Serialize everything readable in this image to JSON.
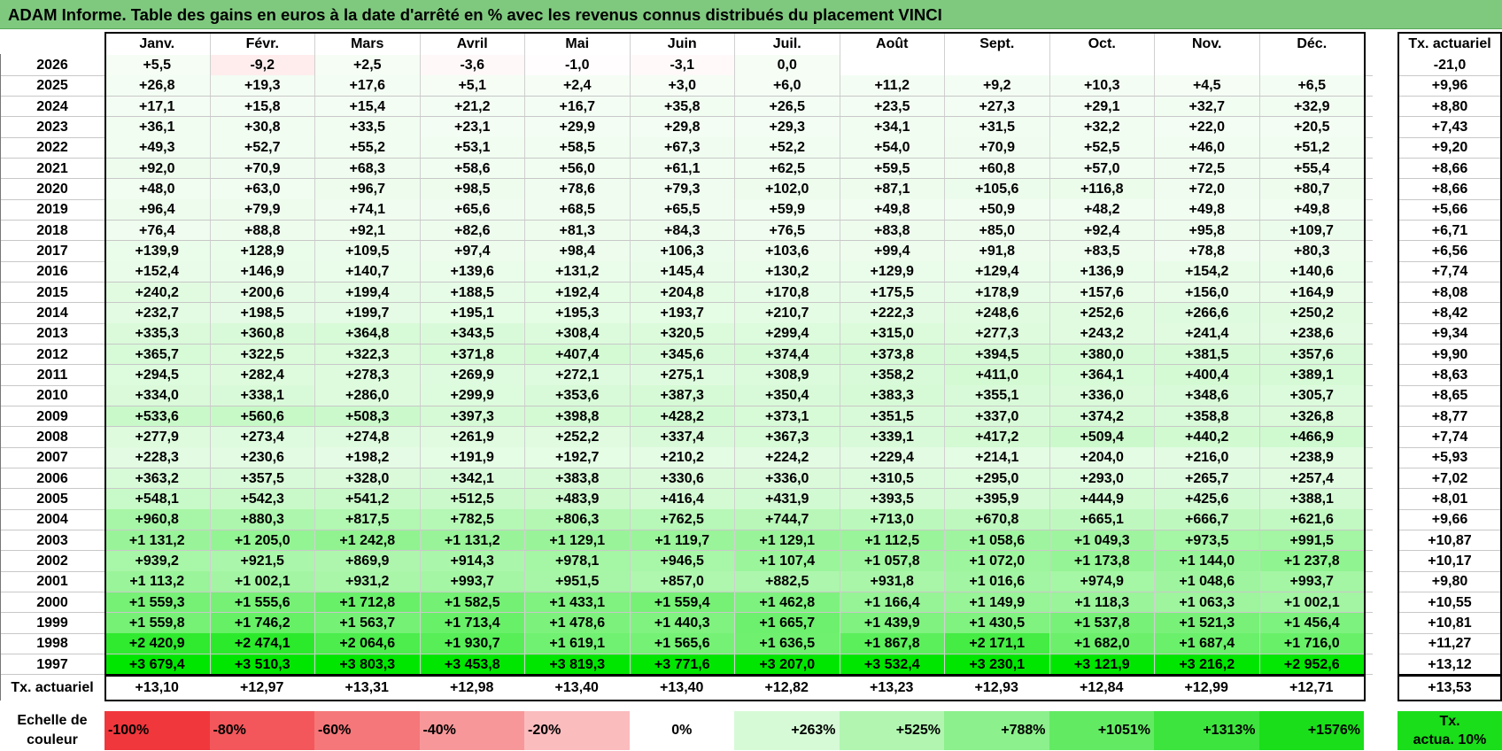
{
  "title": "ADAM Informe. Table des gains en euros à la date d'arrêté en % avec les revenus connus distribués du placement VINCI",
  "months": [
    "Janv.",
    "Févr.",
    "Mars",
    "Avril",
    "Mai",
    "Juin",
    "Juil.",
    "Août",
    "Sept.",
    "Oct.",
    "Nov.",
    "Déc."
  ],
  "rate_header": "Tx. actuariel",
  "rows": [
    {
      "year": "2026",
      "values": [
        "+5,5",
        "-9,2",
        "+2,5",
        "-3,6",
        "-1,0",
        "-3,1",
        "0,0",
        "",
        "",
        "",
        "",
        ""
      ],
      "rate": "-21,0"
    },
    {
      "year": "2025",
      "values": [
        "+26,8",
        "+19,3",
        "+17,6",
        "+5,1",
        "+2,4",
        "+3,0",
        "+6,0",
        "+11,2",
        "+9,2",
        "+10,3",
        "+4,5",
        "+6,5"
      ],
      "rate": "+9,96"
    },
    {
      "year": "2024",
      "values": [
        "+17,1",
        "+15,8",
        "+15,4",
        "+21,2",
        "+16,7",
        "+35,8",
        "+26,5",
        "+23,5",
        "+27,3",
        "+29,1",
        "+32,7",
        "+32,9"
      ],
      "rate": "+8,80"
    },
    {
      "year": "2023",
      "values": [
        "+36,1",
        "+30,8",
        "+33,5",
        "+23,1",
        "+29,9",
        "+29,8",
        "+29,3",
        "+34,1",
        "+31,5",
        "+32,2",
        "+22,0",
        "+20,5"
      ],
      "rate": "+7,43"
    },
    {
      "year": "2022",
      "values": [
        "+49,3",
        "+52,7",
        "+55,2",
        "+53,1",
        "+58,5",
        "+67,3",
        "+52,2",
        "+54,0",
        "+70,9",
        "+52,5",
        "+46,0",
        "+51,2"
      ],
      "rate": "+9,20"
    },
    {
      "year": "2021",
      "values": [
        "+92,0",
        "+70,9",
        "+68,3",
        "+58,6",
        "+56,0",
        "+61,1",
        "+62,5",
        "+59,5",
        "+60,8",
        "+57,0",
        "+72,5",
        "+55,4"
      ],
      "rate": "+8,66"
    },
    {
      "year": "2020",
      "values": [
        "+48,0",
        "+63,0",
        "+96,7",
        "+98,5",
        "+78,6",
        "+79,3",
        "+102,0",
        "+87,1",
        "+105,6",
        "+116,8",
        "+72,0",
        "+80,7"
      ],
      "rate": "+8,66"
    },
    {
      "year": "2019",
      "values": [
        "+96,4",
        "+79,9",
        "+74,1",
        "+65,6",
        "+68,5",
        "+65,5",
        "+59,9",
        "+49,8",
        "+50,9",
        "+48,2",
        "+49,8",
        "+49,8"
      ],
      "rate": "+5,66"
    },
    {
      "year": "2018",
      "values": [
        "+76,4",
        "+88,8",
        "+92,1",
        "+82,6",
        "+81,3",
        "+84,3",
        "+76,5",
        "+83,8",
        "+85,0",
        "+92,4",
        "+95,8",
        "+109,7"
      ],
      "rate": "+6,71"
    },
    {
      "year": "2017",
      "values": [
        "+139,9",
        "+128,9",
        "+109,5",
        "+97,4",
        "+98,4",
        "+106,3",
        "+103,6",
        "+99,4",
        "+91,8",
        "+83,5",
        "+78,8",
        "+80,3"
      ],
      "rate": "+6,56"
    },
    {
      "year": "2016",
      "values": [
        "+152,4",
        "+146,9",
        "+140,7",
        "+139,6",
        "+131,2",
        "+145,4",
        "+130,2",
        "+129,9",
        "+129,4",
        "+136,9",
        "+154,2",
        "+140,6"
      ],
      "rate": "+7,74"
    },
    {
      "year": "2015",
      "values": [
        "+240,2",
        "+200,6",
        "+199,4",
        "+188,5",
        "+192,4",
        "+204,8",
        "+170,8",
        "+175,5",
        "+178,9",
        "+157,6",
        "+156,0",
        "+164,9"
      ],
      "rate": "+8,08"
    },
    {
      "year": "2014",
      "values": [
        "+232,7",
        "+198,5",
        "+199,7",
        "+195,1",
        "+195,3",
        "+193,7",
        "+210,7",
        "+222,3",
        "+248,6",
        "+252,6",
        "+266,6",
        "+250,2"
      ],
      "rate": "+8,42"
    },
    {
      "year": "2013",
      "values": [
        "+335,3",
        "+360,8",
        "+364,8",
        "+343,5",
        "+308,4",
        "+320,5",
        "+299,4",
        "+315,0",
        "+277,3",
        "+243,2",
        "+241,4",
        "+238,6"
      ],
      "rate": "+9,34"
    },
    {
      "year": "2012",
      "values": [
        "+365,7",
        "+322,5",
        "+322,3",
        "+371,8",
        "+407,4",
        "+345,6",
        "+374,4",
        "+373,8",
        "+394,5",
        "+380,0",
        "+381,5",
        "+357,6"
      ],
      "rate": "+9,90"
    },
    {
      "year": "2011",
      "values": [
        "+294,5",
        "+282,4",
        "+278,3",
        "+269,9",
        "+272,1",
        "+275,1",
        "+308,9",
        "+358,2",
        "+411,0",
        "+364,1",
        "+400,4",
        "+389,1"
      ],
      "rate": "+8,63"
    },
    {
      "year": "2010",
      "values": [
        "+334,0",
        "+338,1",
        "+286,0",
        "+299,9",
        "+353,6",
        "+387,3",
        "+350,4",
        "+383,3",
        "+355,1",
        "+336,0",
        "+348,6",
        "+305,7"
      ],
      "rate": "+8,65"
    },
    {
      "year": "2009",
      "values": [
        "+533,6",
        "+560,6",
        "+508,3",
        "+397,3",
        "+398,8",
        "+428,2",
        "+373,1",
        "+351,5",
        "+337,0",
        "+374,2",
        "+358,8",
        "+326,8"
      ],
      "rate": "+8,77"
    },
    {
      "year": "2008",
      "values": [
        "+277,9",
        "+273,4",
        "+274,8",
        "+261,9",
        "+252,2",
        "+337,4",
        "+367,3",
        "+339,1",
        "+417,2",
        "+509,4",
        "+440,2",
        "+466,9"
      ],
      "rate": "+7,74"
    },
    {
      "year": "2007",
      "values": [
        "+228,3",
        "+230,6",
        "+198,2",
        "+191,9",
        "+192,7",
        "+210,2",
        "+224,2",
        "+229,4",
        "+214,1",
        "+204,0",
        "+216,0",
        "+238,9"
      ],
      "rate": "+5,93"
    },
    {
      "year": "2006",
      "values": [
        "+363,2",
        "+357,5",
        "+328,0",
        "+342,1",
        "+383,8",
        "+330,6",
        "+336,0",
        "+310,5",
        "+295,0",
        "+293,0",
        "+265,7",
        "+257,4"
      ],
      "rate": "+7,02"
    },
    {
      "year": "2005",
      "values": [
        "+548,1",
        "+542,3",
        "+541,2",
        "+512,5",
        "+483,9",
        "+416,4",
        "+431,9",
        "+393,5",
        "+395,9",
        "+444,9",
        "+425,6",
        "+388,1"
      ],
      "rate": "+8,01"
    },
    {
      "year": "2004",
      "values": [
        "+960,8",
        "+880,3",
        "+817,5",
        "+782,5",
        "+806,3",
        "+762,5",
        "+744,7",
        "+713,0",
        "+670,8",
        "+665,1",
        "+666,7",
        "+621,6"
      ],
      "rate": "+9,66"
    },
    {
      "year": "2003",
      "values": [
        "+1 131,2",
        "+1 205,0",
        "+1 242,8",
        "+1 131,2",
        "+1 129,1",
        "+1 119,7",
        "+1 129,1",
        "+1 112,5",
        "+1 058,6",
        "+1 049,3",
        "+973,5",
        "+991,5"
      ],
      "rate": "+10,87"
    },
    {
      "year": "2002",
      "values": [
        "+939,2",
        "+921,5",
        "+869,9",
        "+914,3",
        "+978,1",
        "+946,5",
        "+1 107,4",
        "+1 057,8",
        "+1 072,0",
        "+1 173,8",
        "+1 144,0",
        "+1 237,8"
      ],
      "rate": "+10,17"
    },
    {
      "year": "2001",
      "values": [
        "+1 113,2",
        "+1 002,1",
        "+931,2",
        "+993,7",
        "+951,5",
        "+857,0",
        "+882,5",
        "+931,8",
        "+1 016,6",
        "+974,9",
        "+1 048,6",
        "+993,7"
      ],
      "rate": "+9,80"
    },
    {
      "year": "2000",
      "values": [
        "+1 559,3",
        "+1 555,6",
        "+1 712,8",
        "+1 582,5",
        "+1 433,1",
        "+1 559,4",
        "+1 462,8",
        "+1 166,4",
        "+1 149,9",
        "+1 118,3",
        "+1 063,3",
        "+1 002,1"
      ],
      "rate": "+10,55"
    },
    {
      "year": "1999",
      "values": [
        "+1 559,8",
        "+1 746,2",
        "+1 563,7",
        "+1 713,4",
        "+1 478,6",
        "+1 440,3",
        "+1 665,7",
        "+1 439,9",
        "+1 430,5",
        "+1 537,8",
        "+1 521,3",
        "+1 456,4"
      ],
      "rate": "+10,81"
    },
    {
      "year": "1998",
      "values": [
        "+2 420,9",
        "+2 474,1",
        "+2 064,6",
        "+1 930,7",
        "+1 619,1",
        "+1 565,6",
        "+1 636,5",
        "+1 867,8",
        "+2 171,1",
        "+1 682,0",
        "+1 687,4",
        "+1 716,0"
      ],
      "rate": "+11,27"
    },
    {
      "year": "1997",
      "values": [
        "+3 679,4",
        "+3 510,3",
        "+3 803,3",
        "+3 453,8",
        "+3 819,3",
        "+3 771,6",
        "+3 207,0",
        "+3 532,4",
        "+3 230,1",
        "+3 121,9",
        "+3 216,2",
        "+2 952,6"
      ],
      "rate": "+13,12"
    }
  ],
  "rate_row": {
    "label": "Tx. actuariel",
    "values": [
      "+13,10",
      "+12,97",
      "+13,31",
      "+12,98",
      "+13,40",
      "+13,40",
      "+12,82",
      "+13,23",
      "+12,93",
      "+12,84",
      "+12,99",
      "+12,71"
    ],
    "rate": "+13,53"
  },
  "legend": {
    "label_line1": "Echelle de",
    "label_line2": "couleur",
    "steps": [
      {
        "text": "-100%",
        "color": "#f0373c",
        "align": "left"
      },
      {
        "text": "-80%",
        "color": "#f3575b",
        "align": "left"
      },
      {
        "text": "-60%",
        "color": "#f5777a",
        "align": "left"
      },
      {
        "text": "-40%",
        "color": "#f89799",
        "align": "left"
      },
      {
        "text": "-20%",
        "color": "#fbbcbe",
        "align": "left"
      },
      {
        "text": "0%",
        "color": "#ffffff",
        "align": "center"
      },
      {
        "text": "+263%",
        "color": "#d6fad6",
        "align": "right"
      },
      {
        "text": "+525%",
        "color": "#b1f5b1",
        "align": "right"
      },
      {
        "text": "+788%",
        "color": "#8cf08c",
        "align": "right"
      },
      {
        "text": "+1051%",
        "color": "#63ea63",
        "align": "right"
      },
      {
        "text": "+1313%",
        "color": "#3ee43e",
        "align": "right"
      },
      {
        "text": "+1576%",
        "color": "#1ade1a",
        "align": "right"
      }
    ],
    "rate_key_line1": "Tx.",
    "rate_key_line2": "actua. 10%",
    "rate_key_color": "#1ade1a"
  },
  "colors": {
    "title_bg": "#7fc97f",
    "max_green": "#00e000",
    "max_red": "#f0373c"
  }
}
